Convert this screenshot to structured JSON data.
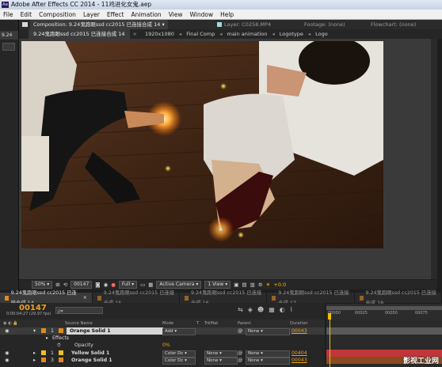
{
  "window": {
    "title": "Adobe After Effects CC 2014 - 11鸡进化女鬼.aep",
    "app_badge": "Ae"
  },
  "menu": [
    "File",
    "Edit",
    "Composition",
    "Layer",
    "Effect",
    "Animation",
    "View",
    "Window",
    "Help"
  ],
  "project_panel": {
    "tab_label": "9.24"
  },
  "viewer_header": {
    "composition_label": "Composition: 9.24鬼跑眼ssd cc2015 已连接合成 14",
    "layer_label": "Layer: C0258.MP4",
    "footage_label": "Footage: (none)",
    "flowchart_label": "Flowchart: (none)"
  },
  "breadcrumb": {
    "active": "9.24鬼跑眼ssd cc2015 已连接合成 14",
    "size": "1920x1080",
    "items": [
      "Final Comp",
      "main animation",
      "Logotype",
      "Logo"
    ]
  },
  "viewer_toolbar": {
    "zoom": "50%",
    "frame": "00147",
    "resolution": "Full",
    "camera": "Active Camera",
    "views": "1 View",
    "exposure": "+0.0"
  },
  "timeline_tabs": [
    {
      "label": "9.24鬼跑眼ssd cc2015 已连接合成 14",
      "active": true
    },
    {
      "label": "9.24鬼跑眼ssd cc2015 已连接合成 15",
      "active": false
    },
    {
      "label": "9.24鬼跑眼ssd cc2015 已连接合成 16",
      "active": false
    },
    {
      "label": "9.24鬼跑眼ssd cc2015 已连接合成 17",
      "active": false
    },
    {
      "label": "9.24鬼跑眼ssd cc2015 已连接合成 18",
      "active": false
    }
  ],
  "timeline": {
    "current_time": "00147",
    "timecode_sub": "0:00:04:27 (29.97 fps)",
    "search_placeholder": "ρ▾",
    "columns": {
      "source_name": "Source Name",
      "mode": "Mode",
      "t": "T",
      "trkmat": "TrkMat",
      "parent": "Parent",
      "duration": "Duration"
    },
    "layers": [
      {
        "num": "1",
        "name": "Orange Solid 1",
        "mode": "Add",
        "trkmat": "",
        "parent": "None",
        "duration": "00043",
        "color": "#e08a1e",
        "selected": true
      },
      {
        "num": "1",
        "name": "Yellow Solid 1",
        "mode": "Color Dc",
        "trkmat": "None",
        "parent": "None",
        "duration": "00404",
        "color": "#e8c21e",
        "selected": false
      },
      {
        "num": "3",
        "name": "Orange Solid 1",
        "mode": "Color Dc",
        "trkmat": "None",
        "parent": "None",
        "duration": "00043",
        "color": "#e08a1e",
        "selected": false
      }
    ],
    "effects_label": "Effects",
    "opacity_label": "Opacity",
    "opacity_value": "0%",
    "ruler_ticks": [
      "00000",
      "00025",
      "00050",
      "00075"
    ]
  },
  "watermark": "影视工业网"
}
